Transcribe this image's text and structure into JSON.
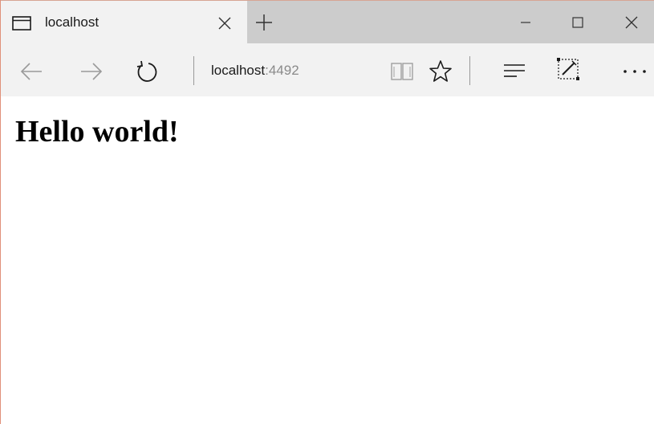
{
  "tab": {
    "title": "localhost",
    "icon": "browser-tab-icon"
  },
  "address_bar": {
    "host": "localhost",
    "port": ":4492"
  },
  "icons": {
    "back": "arrow-left-icon",
    "forward": "arrow-right-icon",
    "refresh": "refresh-icon",
    "reading_view": "book-icon",
    "favorites": "star-icon",
    "hub": "hub-lines-icon",
    "web_note": "pen-note-icon",
    "more": "ellipsis-icon",
    "new_tab": "plus-icon",
    "close_tab": "close-icon",
    "minimize": "minimize-icon",
    "maximize": "maximize-icon",
    "close_window": "close-icon"
  },
  "page": {
    "heading": "Hello world!"
  },
  "colors": {
    "titlebar": "#cccccc",
    "tab_active": "#f2f2f2",
    "toolbar": "#f2f2f2",
    "text": "#1a1a1a",
    "port_text": "#8a8a8a"
  }
}
